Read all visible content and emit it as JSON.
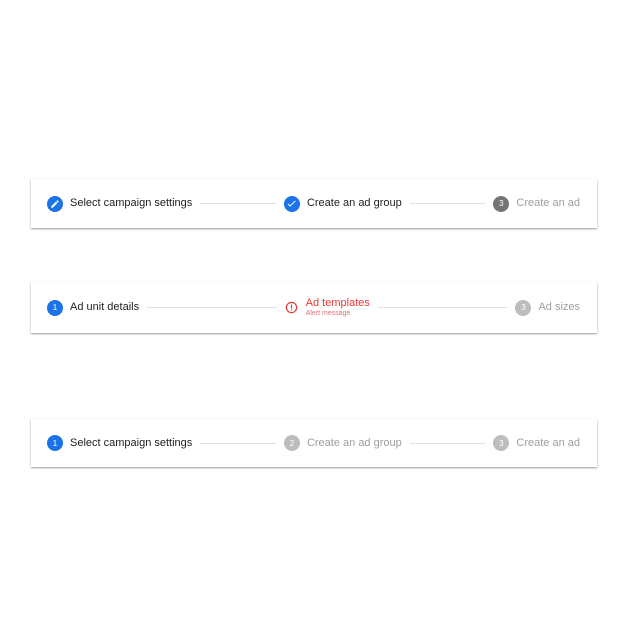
{
  "colors": {
    "accent": "#1a73e8",
    "error": "#e53935",
    "inactive": "#bdbdbd",
    "dark_step": "#757575",
    "text_primary": "#212121",
    "text_disabled": "#9e9e9e"
  },
  "stepper1": {
    "steps": [
      {
        "label": "Select campaign settings",
        "state": "editing",
        "icon": "pencil-icon"
      },
      {
        "label": "Create an ad group",
        "state": "completed",
        "icon": "check-icon"
      },
      {
        "label": "Create an ad",
        "state": "upcoming",
        "number": "3"
      }
    ]
  },
  "stepper2": {
    "steps": [
      {
        "label": "Ad unit details",
        "state": "active",
        "number": "1"
      },
      {
        "label": "Ad templates",
        "sublabel": "Alert message",
        "state": "error",
        "icon": "alert-icon"
      },
      {
        "label": "Ad sizes",
        "state": "inactive",
        "number": "3"
      }
    ]
  },
  "stepper3": {
    "steps": [
      {
        "label": "Select campaign settings",
        "state": "active",
        "number": "1"
      },
      {
        "label": "Create an ad group",
        "state": "inactive",
        "number": "2"
      },
      {
        "label": "Create an ad",
        "state": "inactive",
        "number": "3"
      }
    ]
  }
}
